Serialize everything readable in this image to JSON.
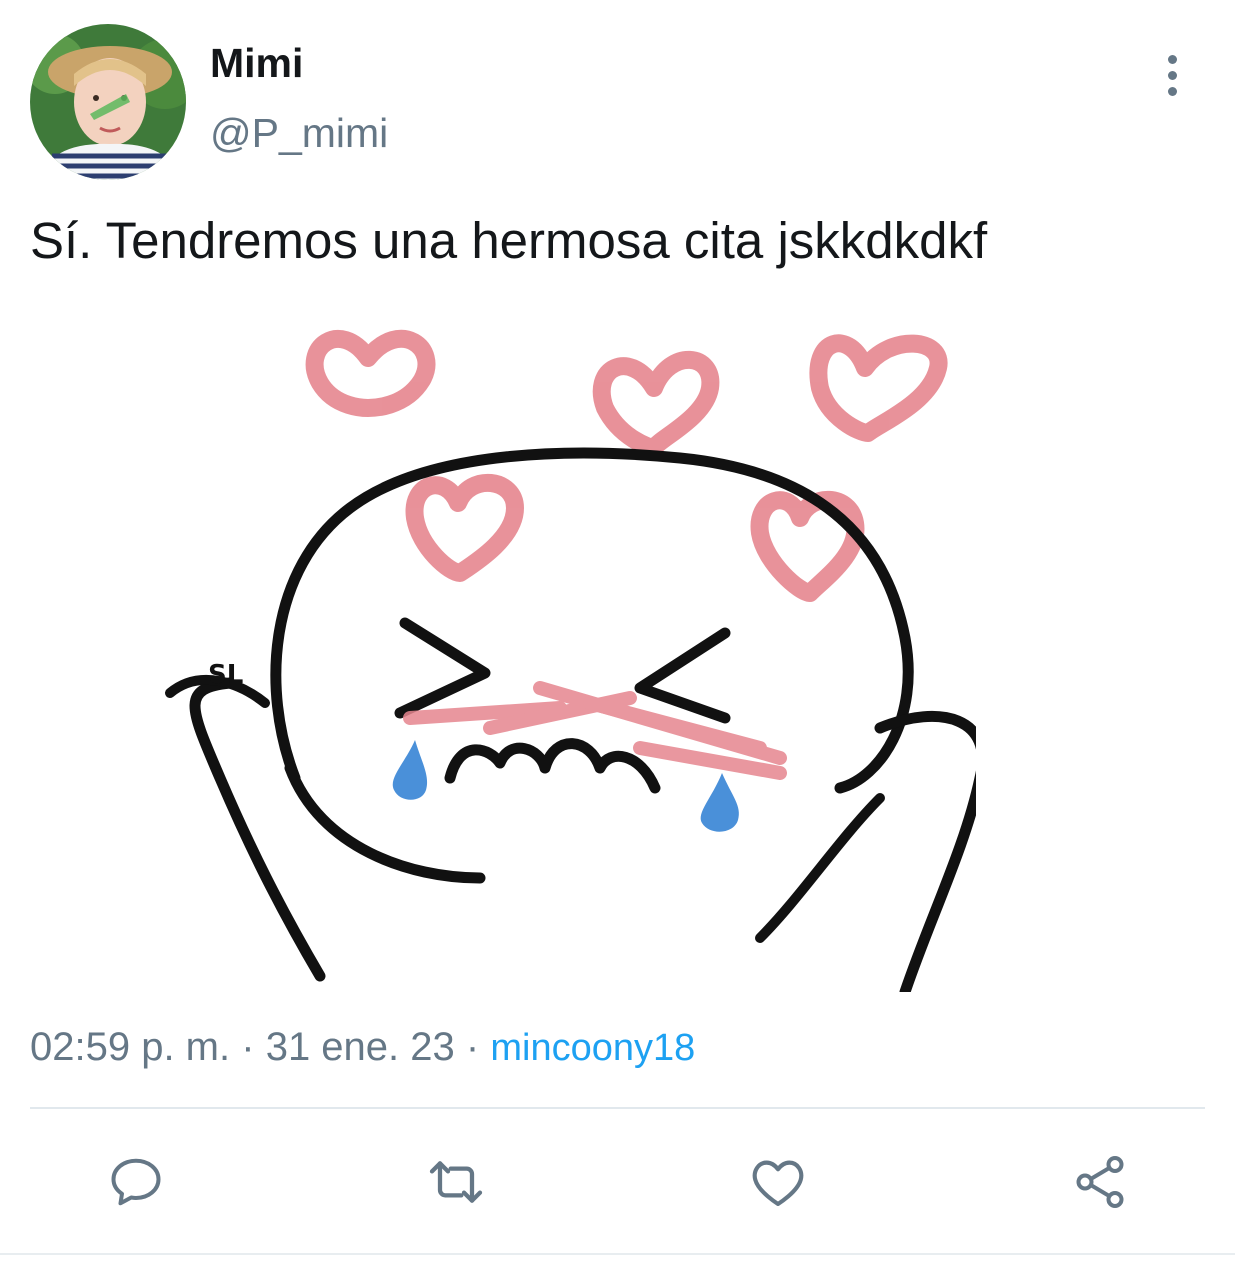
{
  "tweet": {
    "author": {
      "display_name": "Mimi",
      "handle": "@P_mimi",
      "avatar_icon": "profile-photo"
    },
    "text": "Sí. Tendremos una hermosa cita jskkdkdkf",
    "meta": {
      "time": "02:59 p. m.",
      "separator": "·",
      "date": "31 ene. 23",
      "source": "mincoony18"
    },
    "media": {
      "kind": "meme-image",
      "signature": "SL"
    },
    "actions": [
      {
        "name": "reply",
        "icon": "comment-icon"
      },
      {
        "name": "retweet",
        "icon": "retweet-icon"
      },
      {
        "name": "like",
        "icon": "heart-icon"
      },
      {
        "name": "share",
        "icon": "share-icon"
      }
    ],
    "menu_icon": "more-vertical-icon"
  },
  "colors": {
    "text": "#14171a",
    "secondary": "#657786",
    "link": "#1da1f2",
    "divider": "#e1e8ed",
    "heart_pink": "#e6868f",
    "tear_blue": "#4a90d9"
  }
}
